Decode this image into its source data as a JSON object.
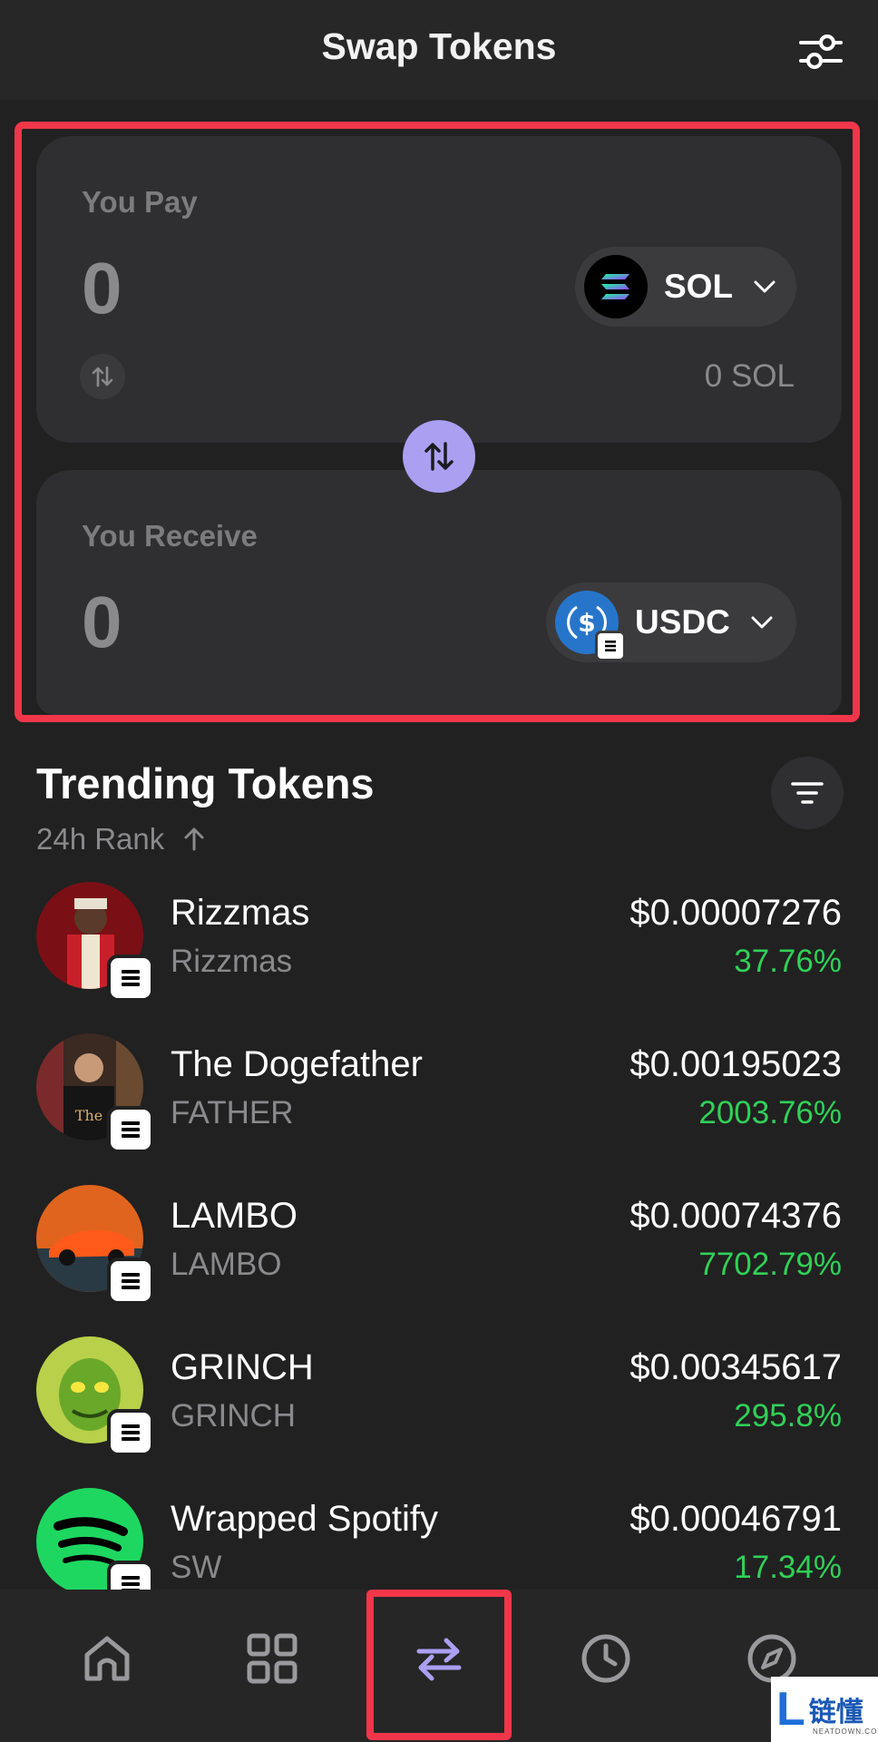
{
  "header": {
    "title": "Swap Tokens",
    "settings_icon": "sliders-icon"
  },
  "swap": {
    "pay": {
      "label": "You Pay",
      "amount": "0",
      "token": "SOL",
      "balance": "0 SOL"
    },
    "receive": {
      "label": "You Receive",
      "amount": "0",
      "token": "USDC"
    },
    "accent": "#ab9ff2"
  },
  "trending": {
    "title": "Trending Tokens",
    "rank_label": "24h Rank",
    "tokens": [
      {
        "name": "Rizzmas",
        "symbol": "Rizzmas",
        "price": "$0.00007276",
        "change": "37.76%"
      },
      {
        "name": "The Dogefather",
        "symbol": "FATHER",
        "price": "$0.00195023",
        "change": "2003.76%"
      },
      {
        "name": "LAMBO",
        "symbol": "LAMBO",
        "price": "$0.00074376",
        "change": "7702.79%"
      },
      {
        "name": "GRINCH",
        "symbol": "GRINCH",
        "price": "$0.00345617",
        "change": "295.8%"
      },
      {
        "name": "Wrapped Spotify",
        "symbol": "SW",
        "price": "$0.00046791",
        "change": "17.34%"
      }
    ],
    "positive_color": "#30d158"
  },
  "nav": {
    "items": [
      "home-icon",
      "grid-icon",
      "swap-icon",
      "history-icon",
      "explore-icon"
    ],
    "active": "swap-icon"
  },
  "watermark": {
    "logo_letter": "L",
    "text": "链懂",
    "sub": "NEATDOWN.COM"
  },
  "highlight_color": "#f2364a"
}
